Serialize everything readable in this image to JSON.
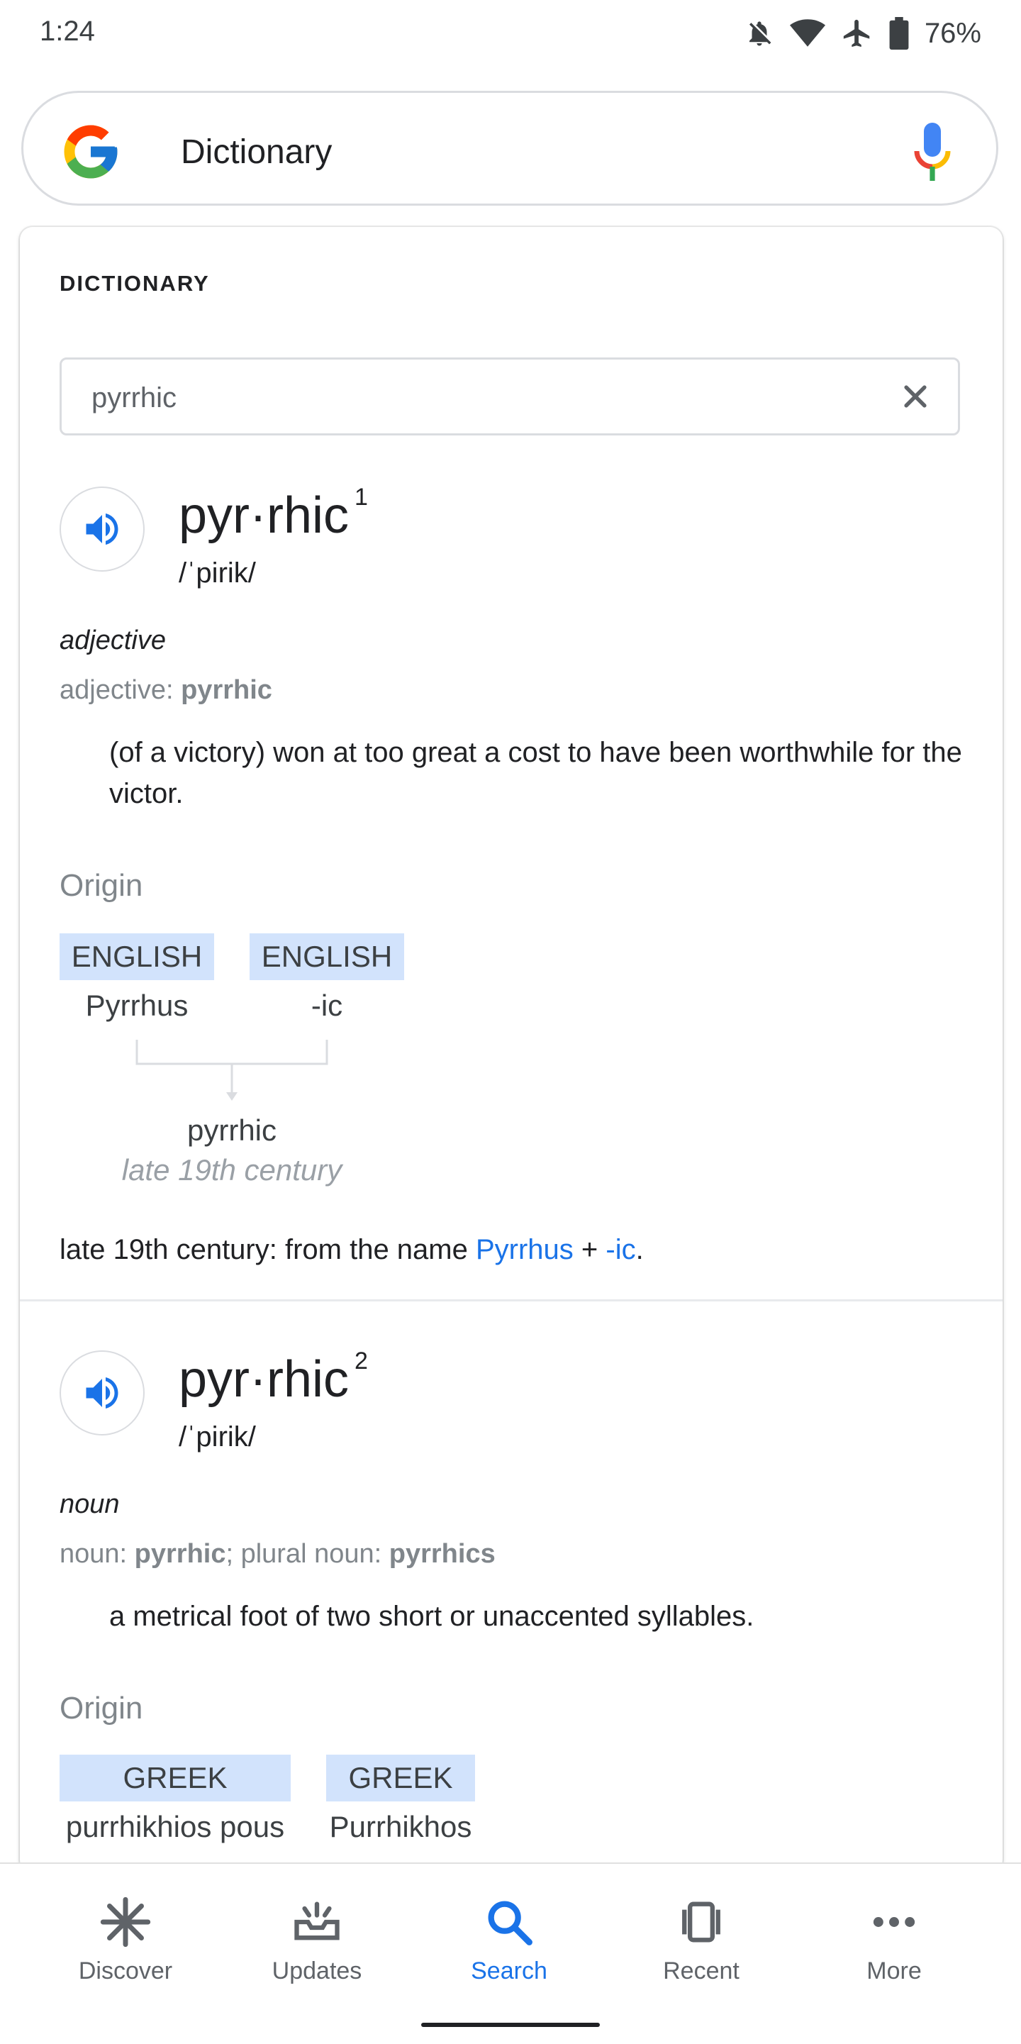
{
  "status_bar": {
    "time": "1:24",
    "battery": "76%"
  },
  "search": {
    "query": "Dictionary"
  },
  "dictionary": {
    "section_title": "DICTIONARY",
    "input_value": "pyrrhic",
    "entries": [
      {
        "headword": "pyr·rhic",
        "sense_number": "1",
        "phonetic": "/ˈpirik/",
        "part_of_speech": "adjective",
        "forms_label": "adjective: ",
        "forms_word": "pyrrhic",
        "definition": "(of a victory) won at too great a cost to have been worthwhile for the victor.",
        "origin_label": "Origin",
        "origin_langs": [
          "ENGLISH",
          "ENGLISH"
        ],
        "origin_words": [
          "Pyrrhus",
          "-ic"
        ],
        "origin_result": "pyrrhic",
        "origin_date": "late 19th century",
        "etymology_prefix": "late 19th century: from the name ",
        "etymology_link1": "Pyrrhus",
        "etymology_plus": " + ",
        "etymology_link2": "-ic",
        "etymology_end": "."
      },
      {
        "headword": "pyr·rhic",
        "sense_number": "2",
        "phonetic": "/ˈpirik/",
        "part_of_speech": "noun",
        "forms_label1": "noun: ",
        "forms_word1": "pyrrhic",
        "forms_label2": "; plural noun: ",
        "forms_word2": "pyrrhics",
        "definition": "a metrical foot of two short or unaccented syllables.",
        "origin_label": "Origin",
        "origin_langs": [
          "GREEK",
          "GREEK"
        ],
        "origin_words": [
          "purrhikhios pous",
          "Purrhikhos"
        ]
      }
    ]
  },
  "bottom_nav": {
    "items": [
      {
        "label": "Discover",
        "icon": "asterisk-icon"
      },
      {
        "label": "Updates",
        "icon": "updates-icon"
      },
      {
        "label": "Search",
        "icon": "search-icon",
        "active": true
      },
      {
        "label": "Recent",
        "icon": "recent-cards-icon"
      },
      {
        "label": "More",
        "icon": "more-dots-icon"
      }
    ]
  },
  "colors": {
    "accent": "#1a73e8",
    "tag_bg": "#d2e3fc",
    "muted": "#80868b"
  }
}
